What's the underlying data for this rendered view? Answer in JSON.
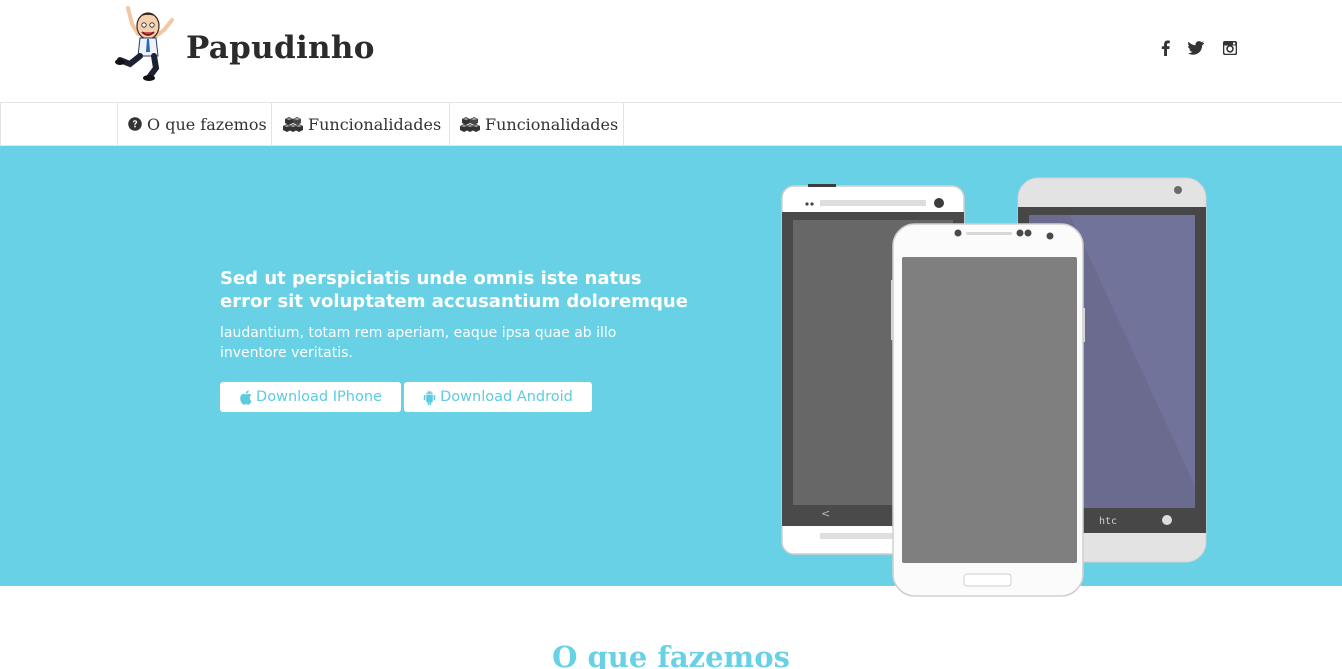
{
  "header": {
    "brand": "Papudinho",
    "social": [
      {
        "icon": "facebook-icon"
      },
      {
        "icon": "twitter-icon"
      },
      {
        "icon": "instagram-icon"
      }
    ]
  },
  "nav": {
    "items": [
      {
        "label": "O que fazemos",
        "icon": "question-circle-icon"
      },
      {
        "label": "Funcionalidades",
        "icon": "cubes-icon"
      },
      {
        "label": "Funcionalidades",
        "icon": "cubes-icon"
      }
    ]
  },
  "hero": {
    "title": "Sed ut perspiciatis unde omnis iste natus error sit voluptatem accusantium doloremque",
    "subtitle": "laudantium, totam rem aperiam, eaque ipsa quae ab illo inventore veritatis.",
    "buttons": [
      {
        "label": "Download IPhone",
        "icon": "apple-icon"
      },
      {
        "label": "Download Android",
        "icon": "android-icon"
      }
    ],
    "phone_brand": "htc"
  },
  "section": {
    "title": "O que fazemos"
  },
  "colors": {
    "accent": "#68d1e6",
    "button_text": "#5ccbe1",
    "text_dark": "#2b2b2b"
  }
}
